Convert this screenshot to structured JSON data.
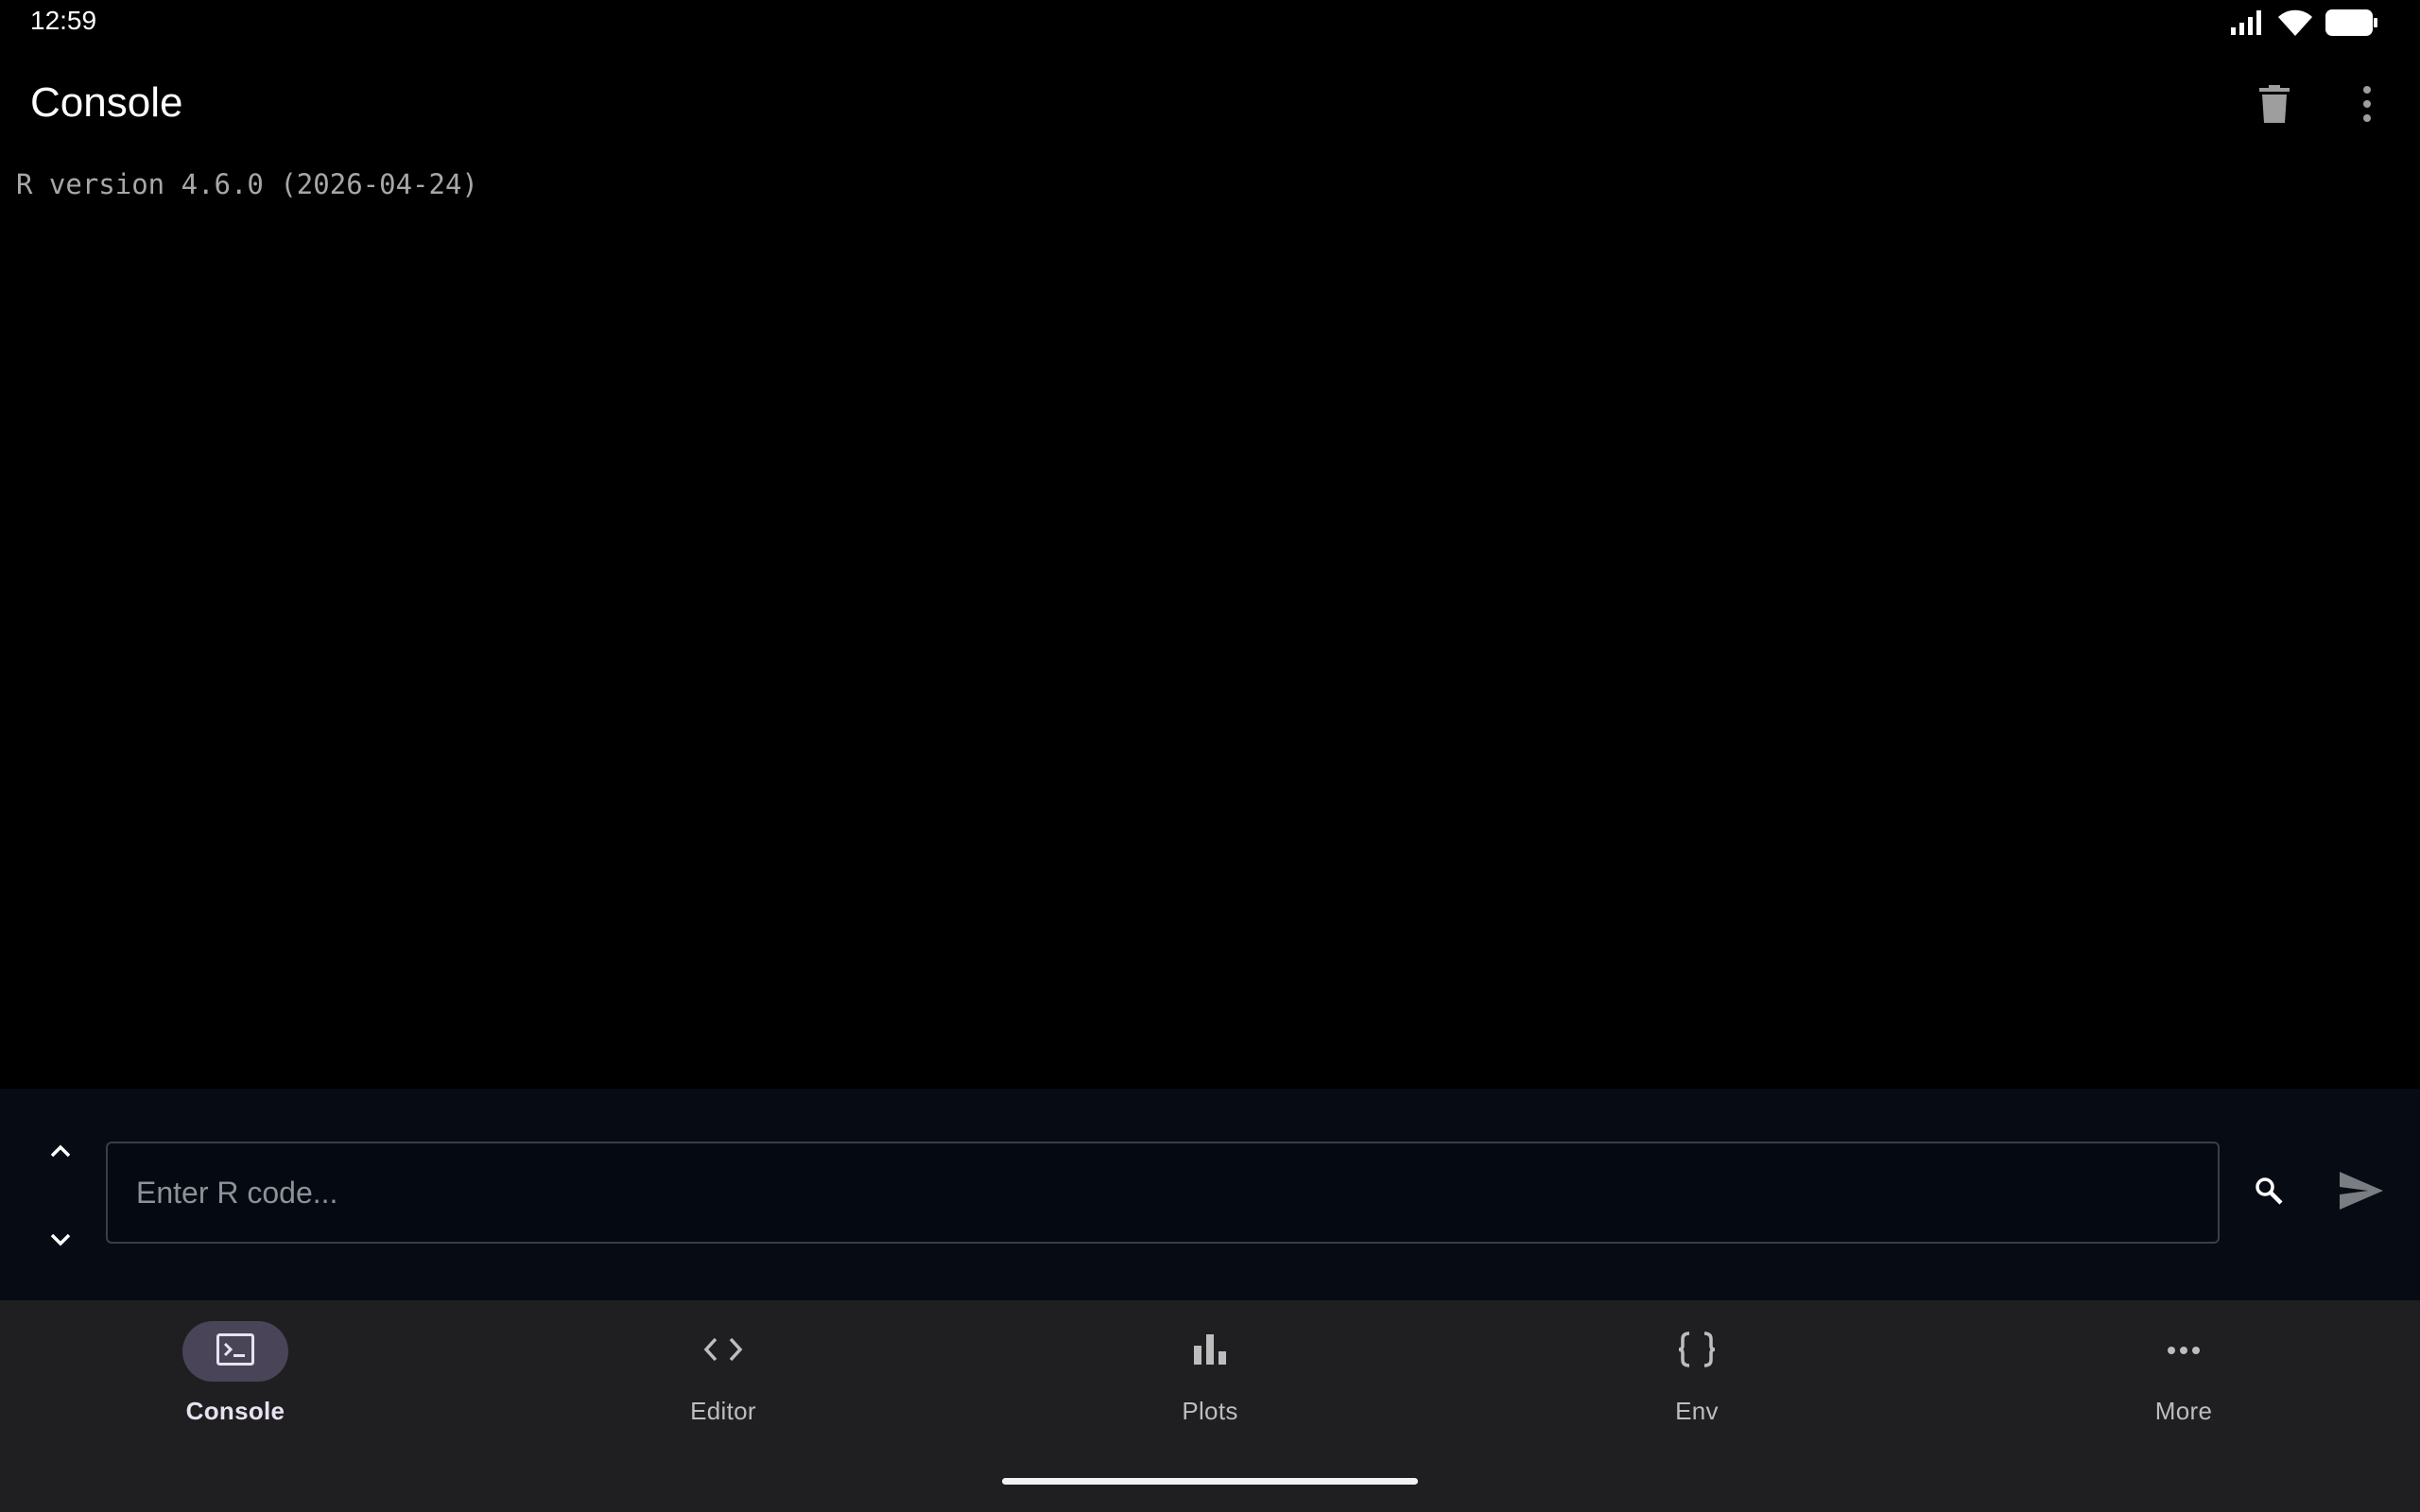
{
  "status_bar": {
    "time": "12:59",
    "icons": [
      "signal-icon",
      "wifi-icon",
      "battery-icon"
    ]
  },
  "app_bar": {
    "title": "Console",
    "actions": [
      "trash-icon",
      "more-vert-icon"
    ]
  },
  "console": {
    "lines": [
      "R version 4.6.0 (2026-04-24)"
    ]
  },
  "input": {
    "placeholder": "Enter R code...",
    "value": ""
  },
  "bottom_nav": {
    "items": [
      {
        "label": "Console",
        "icon": "terminal-icon",
        "active": true
      },
      {
        "label": "Editor",
        "icon": "code-icon",
        "active": false
      },
      {
        "label": "Plots",
        "icon": "bar-chart-icon",
        "active": false
      },
      {
        "label": "Env",
        "icon": "braces-icon",
        "active": false
      },
      {
        "label": "More",
        "icon": "more-horiz-icon",
        "active": false
      }
    ]
  },
  "colors": {
    "background": "#000000",
    "input_panel": "#060b14",
    "nav_background": "#1f1f21",
    "active_pill": "#4a4458",
    "console_text": "#a7a7a7"
  }
}
